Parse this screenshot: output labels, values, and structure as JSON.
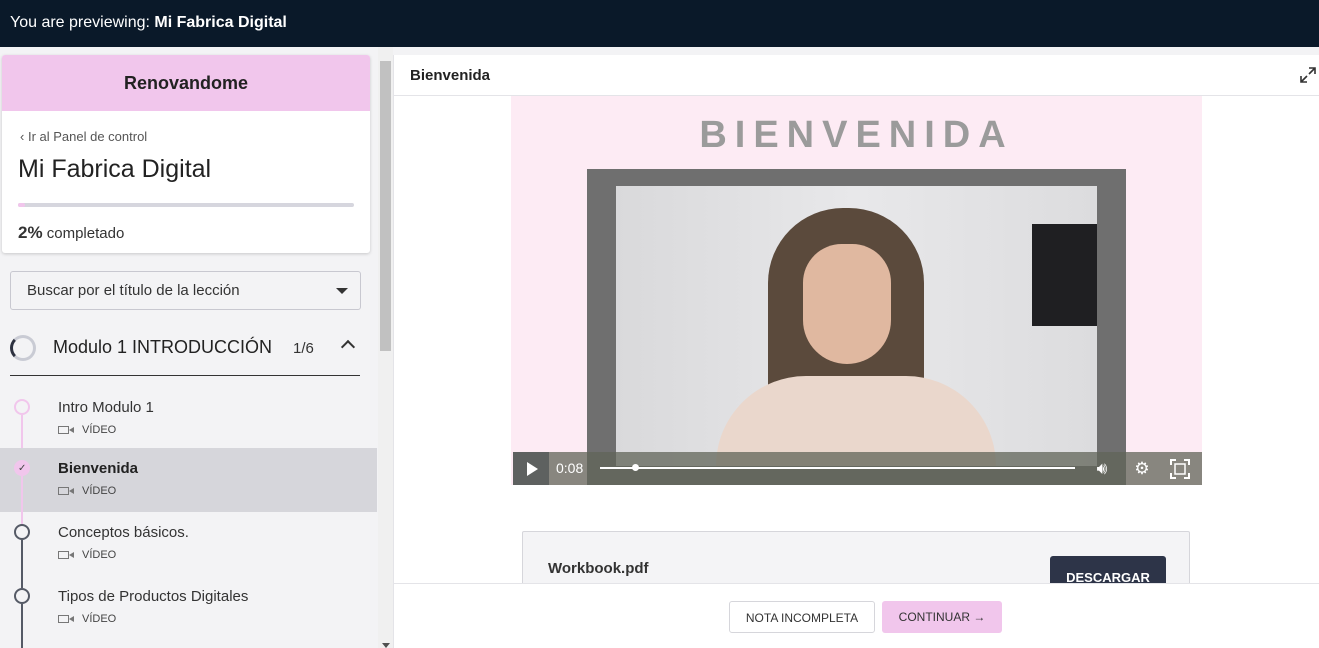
{
  "topbar": {
    "prefix": "You are previewing: ",
    "school": "Mi Fabrica Digital"
  },
  "course": {
    "school_name": "Renovandome",
    "back_link": "Ir al Panel de control",
    "title": "Mi Fabrica Digital",
    "progress_percent": 2,
    "progress_value": "2%",
    "progress_label": "completado"
  },
  "search": {
    "placeholder": "Buscar por el título de la lección"
  },
  "module": {
    "title": "Modulo 1 INTRODUCCIÓN",
    "count": "1/6"
  },
  "lessons": [
    {
      "title": "Intro Modulo 1",
      "type": "VÍDEO",
      "state": "next"
    },
    {
      "title": "Bienvenida",
      "type": "VÍDEO",
      "state": "active"
    },
    {
      "title": "Conceptos básicos.",
      "type": "VÍDEO",
      "state": "default"
    },
    {
      "title": "Tipos de Productos Digitales",
      "type": "VÍDEO",
      "state": "default"
    }
  ],
  "lesson_view": {
    "title": "Bienvenida",
    "banner_text": "BIENVENIDA",
    "video": {
      "time": "0:08"
    },
    "attachment": {
      "name": "Workbook.pdf",
      "download_label": "DESCARGAR"
    }
  },
  "footer": {
    "incomplete_label": "NOTA INCOMPLETA",
    "continue_label": "CONTINUAR →"
  },
  "colors": {
    "topbar": "#0a1929",
    "accent_pink": "#f1c6ec",
    "dark_button": "#2d3448"
  }
}
